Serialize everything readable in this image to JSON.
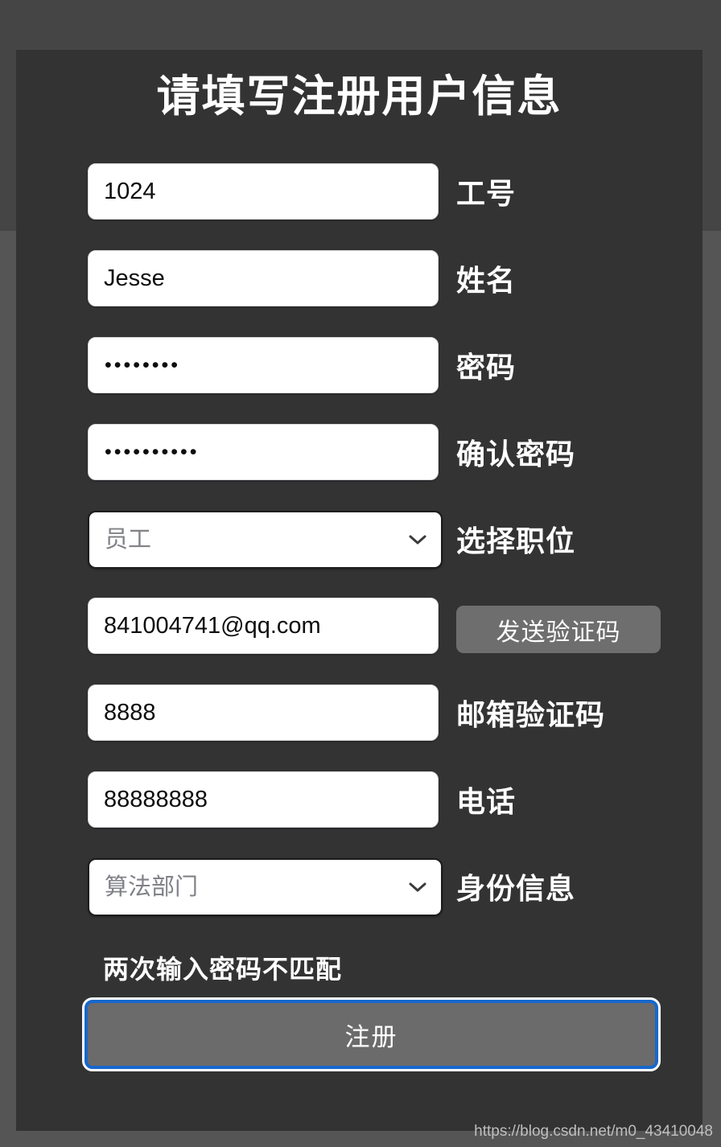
{
  "page": {
    "title": "请填写注册用户信息",
    "watermark": "https://blog.csdn.net/m0_43410048",
    "error_message": "两次输入密码不匹配",
    "accent_blue": "#1668cc",
    "panel_bg": "#333334",
    "outer_bg": "#555556",
    "band_bg": "#454545",
    "button_gray": "#6e6e6e"
  },
  "form": {
    "fields": [
      {
        "name": "employee-id",
        "value": "1024",
        "label": "工号",
        "type": "text"
      },
      {
        "name": "full-name",
        "value": "Jesse",
        "label": "姓名",
        "type": "text"
      },
      {
        "name": "password",
        "value": "••••••••",
        "label": "密码",
        "type": "password"
      },
      {
        "name": "confirm-password",
        "value": "••••••••••",
        "label": "确认密码",
        "type": "password"
      },
      {
        "name": "position",
        "value": "员工",
        "label": "选择职位",
        "type": "select"
      },
      {
        "name": "email",
        "value": "841004741@qq.com",
        "label": "发送验证码",
        "type": "text-with-button"
      },
      {
        "name": "email-code",
        "value": "8888",
        "label": "邮箱验证码",
        "type": "text"
      },
      {
        "name": "phone",
        "value": "88888888",
        "label": "电话",
        "type": "text"
      },
      {
        "name": "department",
        "value": "算法部门",
        "label": "身份信息",
        "type": "select"
      }
    ],
    "submit_label": "注册",
    "send_code_label": "发送验证码"
  }
}
